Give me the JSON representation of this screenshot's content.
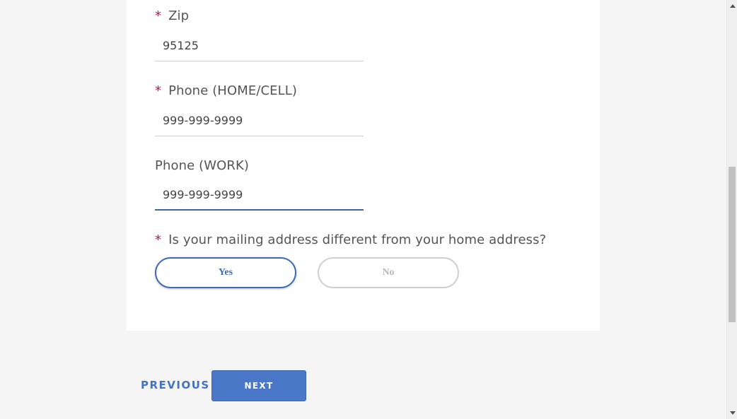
{
  "form": {
    "zip": {
      "label": "Zip",
      "required_marker": "*",
      "value": "95125"
    },
    "phone_home": {
      "label": "Phone (HOME/CELL)",
      "required_marker": "*",
      "value": "999-999-9999"
    },
    "phone_work": {
      "label": "Phone (WORK)",
      "value": "999-999-9999"
    },
    "mailing_question": {
      "label": "Is your mailing address different from your home address?",
      "required_marker": "*",
      "options": [
        {
          "label": "Yes",
          "selected": true
        },
        {
          "label": "No",
          "selected": false
        }
      ]
    }
  },
  "navigation": {
    "previous_label": "PREVIOUS",
    "next_label": "NEXT"
  },
  "colors": {
    "accent": "#4a77c8",
    "required": "#d0103a",
    "page_background": "#f5f5f5",
    "card_background": "#ffffff"
  },
  "scrollbar": {
    "up_icon": "scroll-up-arrow-icon",
    "down_icon": "scroll-down-arrow-icon"
  }
}
